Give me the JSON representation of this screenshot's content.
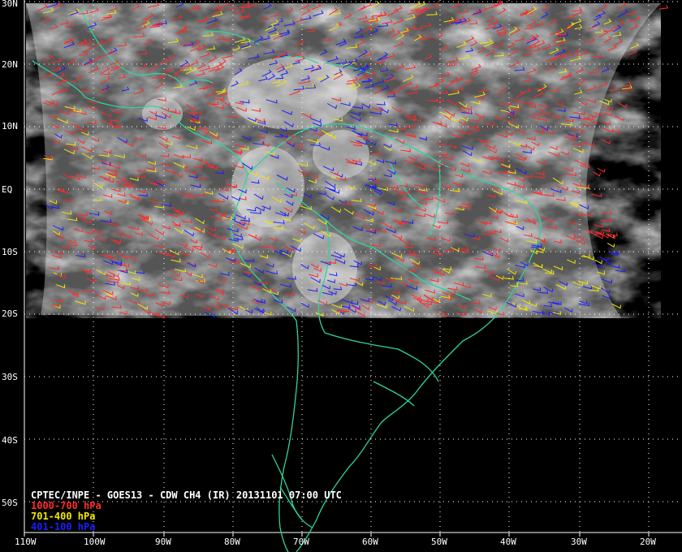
{
  "map": {
    "title": "CPTEC/INPE - GOES13 - CDW CH4 (IR) 20131101 07:00 UTC",
    "legend": [
      {
        "label": "1000-700 hPa",
        "color": "#ff2a2a"
      },
      {
        "label": "701-400 hPa",
        "color": "#f2e600"
      },
      {
        "label": "401-100 hPa",
        "color": "#1e1eff"
      }
    ],
    "lat_labels": [
      "30N",
      "20N",
      "10N",
      "EQ",
      "10S",
      "20S",
      "30S",
      "40S",
      "50S"
    ],
    "lon_labels": [
      "110W",
      "100W",
      "90W",
      "80W",
      "70W",
      "60W",
      "50W",
      "40W",
      "30W",
      "20W"
    ],
    "coastline_color": "#2ed3a0",
    "grid_color": "#ffffff",
    "satellite": "GOES13",
    "channel": "CH4 (IR)",
    "datetime": "20131101 07:00 UTC",
    "source": "CPTEC/INPE",
    "product": "CDW"
  }
}
